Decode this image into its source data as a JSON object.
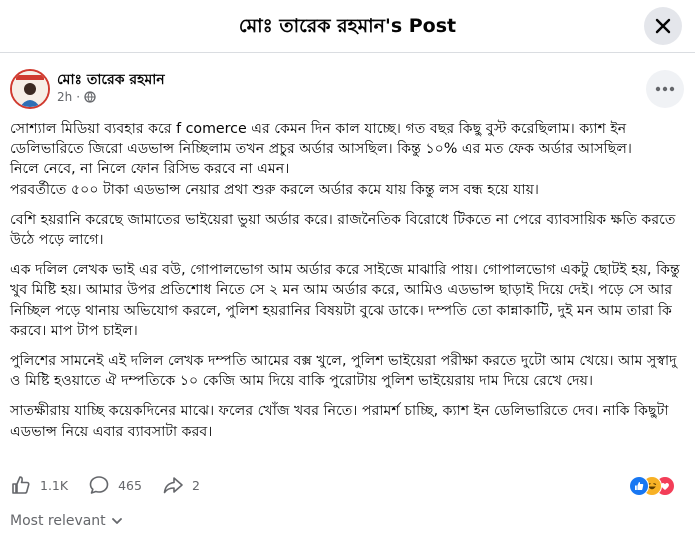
{
  "header": {
    "title": "মোঃ তারেক রহমান's Post"
  },
  "post": {
    "author": "মোঃ তারেক রহমান",
    "time": "2h",
    "paragraphs": [
      "সোশ্যাল মিডিয়া ব্যবহার করে f comerce এর কেমন দিন কাল যাচ্ছে। গত বছর কিছু বুস্ট করেছিলাম। ক্যাশ ইন ডেলিভারিতে জিরো এডভান্স নিচ্ছিলাম তখন প্রচুর অর্ডার আসছিল। কিন্তু ১০% এর মত ফেক অর্ডার আসছিল।\nনিলে নেবে, না নিলে ফোন রিসিভ করবে না এমন।\nপরবর্তীতে ৫০০ টাকা এডভান্স নেয়ার প্রথা শুরু করলে অর্ডার কমে যায় কিন্তু লস বন্ধ হয়ে যায়।",
      "বেশি হয়রানি করেছে জামাতের ভাইয়েরা ভুয়া অর্ডার করে। রাজনৈতিক বিরোধে টিকতে না পেরে ব্যাবসায়িক ক্ষতি করতে উঠে পড়ে লাগে।",
      "এক দলিল লেখক ভাই এর বউ, গোপালভোগ আম অর্ডার করে সাইজে মাঝারি পায়। গোপালভোগ একটু ছোটই হয়, কিন্তু খুব মিষ্টি হয়। আমার উপর প্রতিশোধ নিতে সে ২ মন আম অর্ডার করে, আমিও এডভান্স ছাড়াই দিয়ে দেই। পড়ে সে  আর নিচ্ছিল  পড়ে থানায় অভিযোগ করলে, পুলিশ হয়রানির বিষয়টা বুঝে ডাকে। দম্পতি তো কান্নাকাটি, দুই মন আম তারা কি করবে। মাপ টাপ চাইল।",
      "পুলিশের সামনেই এই দলিল লেখক দম্পতি আমের বক্স খুলে,  পুলিশ ভাইয়েরা পরীক্ষা করতে দুটো আম খেয়ে। আম সুস্বাদু ও মিষ্টি হওয়াতে ঐ দম্পতিকে  ১০ কেজি আম দিয়ে বাকি পুরোটায় পুলিশ ভাইয়েরায় দাম দিয়ে রেখে দেয়।",
      "সাতক্ষীরায় যাচ্ছি কয়েকদিনের মাঝে। ফলের খোঁজ খবর নিতে। পরামর্শ চাচ্ছি, ক্যাশ ইন ডেলিভারিতে দেব। নাকি কিছুটা এডভান্স নিয়ে এবার ব্যাবসাটা করব।"
    ]
  },
  "stats": {
    "likes": "1.1K",
    "comments": "465",
    "shares": "2"
  },
  "sort": {
    "label": "Most relevant"
  },
  "colors": {
    "like_blue": "#1877f2",
    "love_red": "#f33e58",
    "haha_yellow": "#f7b125",
    "muted": "#65676b"
  },
  "icons": [
    "close-icon",
    "globe-icon",
    "more-icon",
    "like-icon",
    "comment-icon",
    "share-icon",
    "chevron-down-icon"
  ]
}
